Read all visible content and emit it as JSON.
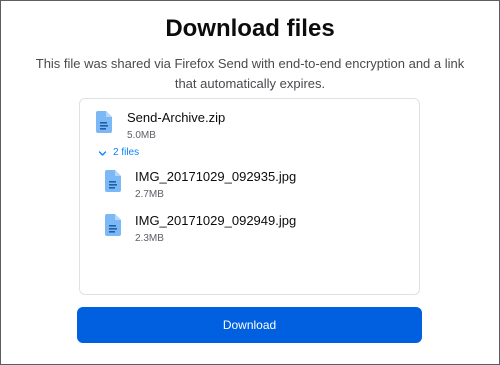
{
  "page": {
    "title": "Download files",
    "subtitle": "This file was shared via Firefox Send with end-to-end encryption and a link that automatically expires."
  },
  "archive": {
    "name": "Send-Archive.zip",
    "size": "5.0MB",
    "icon": "file-icon"
  },
  "file_list": {
    "toggle_label": "2 files",
    "toggle_icon": "chevron-down-icon",
    "files": [
      {
        "name": "IMG_20171029_092935.jpg",
        "size": "2.7MB",
        "icon": "file-icon"
      },
      {
        "name": "IMG_20171029_092949.jpg",
        "size": "2.3MB",
        "icon": "file-icon"
      }
    ]
  },
  "actions": {
    "download_label": "Download"
  },
  "colors": {
    "accent": "#0060df",
    "link": "#0a84ff",
    "file_icon": "#7cb8f6",
    "file_icon_lines": "#ffffff"
  }
}
